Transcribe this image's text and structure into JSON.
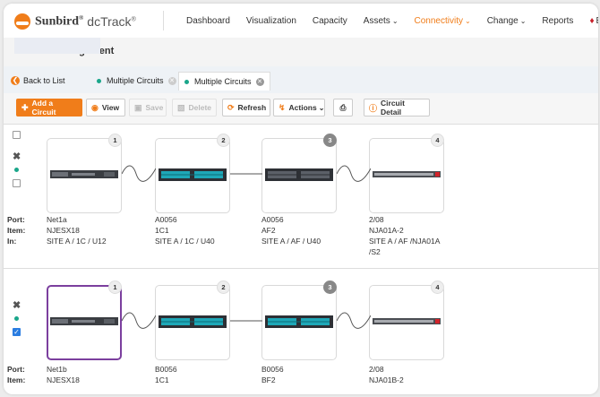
{
  "brand": {
    "name": "Sunbird",
    "reg": "®",
    "product": "dcTrack",
    "product_reg": "®"
  },
  "nav": {
    "items": [
      {
        "label": "Dashboard",
        "dropdown": false,
        "active": false
      },
      {
        "label": "Visualization",
        "dropdown": false,
        "active": false
      },
      {
        "label": "Capacity",
        "dropdown": false,
        "active": false
      },
      {
        "label": "Assets",
        "dropdown": true,
        "active": false
      },
      {
        "label": "Connectivity",
        "dropdown": true,
        "active": true
      },
      {
        "label": "Change",
        "dropdown": true,
        "active": false
      },
      {
        "label": "Reports",
        "dropdown": false,
        "active": false
      }
    ],
    "events_label": "Ev"
  },
  "page": {
    "title": "Circuits Management"
  },
  "tabs": {
    "back": "Back to List",
    "items": [
      "Multiple Circuits",
      "Multiple Circuits"
    ]
  },
  "toolbar": {
    "add": "Add a Circuit",
    "view": "View",
    "save": "Save",
    "delete": "Delete",
    "refresh": "Refresh",
    "actions": "Actions",
    "detail": "Circuit Detail"
  },
  "row_labels": {
    "port": "Port:",
    "item": "Item:",
    "in": "In:"
  },
  "circuits": [
    {
      "checked": false,
      "nodes": [
        {
          "num": "1",
          "port": "Net1a",
          "item": "NJESX18",
          "in": [
            "SITE A / 1C / U12"
          ]
        },
        {
          "num": "2",
          "port": "A0056",
          "item": "1C1",
          "in": [
            "SITE A / 1C / U40"
          ]
        },
        {
          "num": "3",
          "port": "A0056",
          "item": "AF2",
          "in": [
            "SITE A / AF / U40"
          ]
        },
        {
          "num": "4",
          "port": "2/08",
          "item": "NJA01A-2",
          "in": [
            "SITE A / AF /NJA01A",
            "/S2"
          ]
        }
      ]
    },
    {
      "checked": true,
      "nodes": [
        {
          "num": "1",
          "port": "Net1b",
          "item": "NJESX18"
        },
        {
          "num": "2",
          "port": "B0056",
          "item": "1C1"
        },
        {
          "num": "3",
          "port": "B0056",
          "item": "BF2"
        },
        {
          "num": "4",
          "port": "2/08",
          "item": "NJA01B-2"
        }
      ]
    }
  ],
  "colors": {
    "accent": "#f07d1a",
    "status_green": "#1aa68a",
    "selected_border": "#7b3f9e",
    "checkbox_blue": "#2a7de1"
  }
}
